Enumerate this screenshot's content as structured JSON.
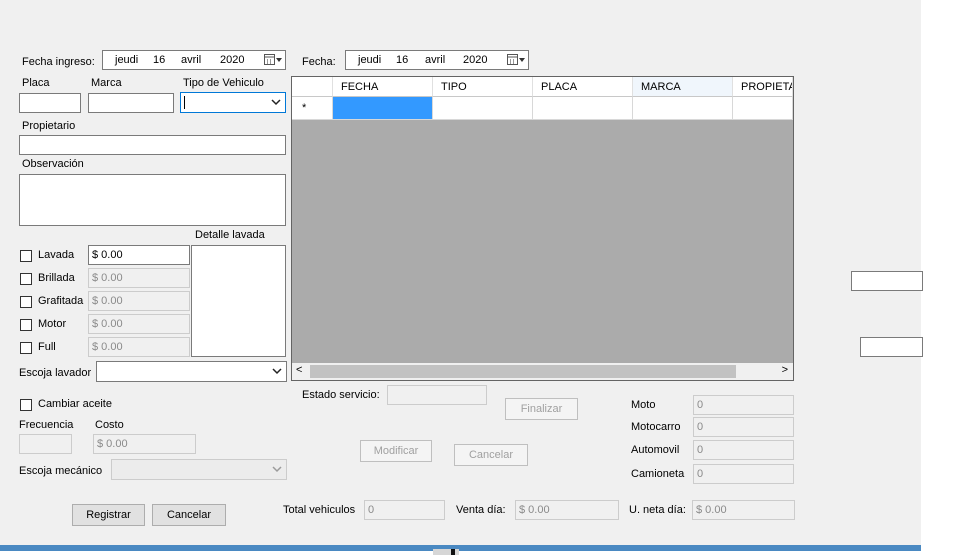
{
  "form": {
    "fecha_ingreso": {
      "label": "Fecha ingreso:",
      "day_name": "jeudi",
      "day": "16",
      "month": "avril",
      "year": "2020"
    },
    "fecha": {
      "label": "Fecha:",
      "day_name": "jeudi",
      "day": "16",
      "month": "avril",
      "year": "2020"
    },
    "placa": {
      "label": "Placa",
      "value": ""
    },
    "marca": {
      "label": "Marca",
      "value": ""
    },
    "tipo_vehiculo": {
      "label": "Tipo de Vehiculo",
      "value": ""
    },
    "propietario": {
      "label": "Propietario",
      "value": ""
    },
    "observacion": {
      "label": "Observación",
      "value": ""
    },
    "detalle_lavada": {
      "label": "Detalle lavada"
    },
    "services": [
      {
        "label": "Lavada",
        "price": "$ 0.00",
        "enabled": true
      },
      {
        "label": "Brillada",
        "price": "$ 0.00",
        "enabled": false
      },
      {
        "label": "Grafitada",
        "price": "$ 0.00",
        "enabled": false
      },
      {
        "label": "Motor",
        "price": "$ 0.00",
        "enabled": false
      },
      {
        "label": "Full",
        "price": "$ 0.00",
        "enabled": false
      }
    ],
    "escoja_lavador": {
      "label": "Escoja lavador",
      "value": ""
    },
    "cambiar_aceite": {
      "label": "Cambiar aceite"
    },
    "frecuencia": {
      "label": "Frecuencia",
      "value": ""
    },
    "costo": {
      "label": "Costo",
      "value": "$ 0.00"
    },
    "escoja_mecanico": {
      "label": "Escoja mecánico",
      "value": ""
    },
    "estado_servicio": {
      "label": "Estado servicio:",
      "value": ""
    },
    "buttons": {
      "registrar": "Registrar",
      "cancelar_left": "Cancelar",
      "finalizar": "Finalizar",
      "modificar": "Modificar",
      "cancelar_mid": "Cancelar"
    },
    "counts": [
      {
        "label": "Moto",
        "value": "0"
      },
      {
        "label": "Motocarro",
        "value": "0"
      },
      {
        "label": "Automovil",
        "value": "0"
      },
      {
        "label": "Camioneta",
        "value": "0"
      }
    ],
    "totals": {
      "total_vehiculos_label": "Total vehiculos",
      "total_vehiculos": "0",
      "venta_dia_label": "Venta día:",
      "venta_dia": "$ 0.00",
      "u_neta_label": "U. neta día:",
      "u_neta": "$ 0.00"
    }
  },
  "grid": {
    "columns": [
      "FECHA",
      "TIPO",
      "PLACA",
      "MARCA",
      "PROPIETA"
    ],
    "new_row_marker": "*",
    "selection_color": "#3399ff"
  },
  "colors": {
    "form_bg": "#f0f0f0",
    "grid_bg": "#ababab",
    "accent_bar": "#4a89c2"
  }
}
